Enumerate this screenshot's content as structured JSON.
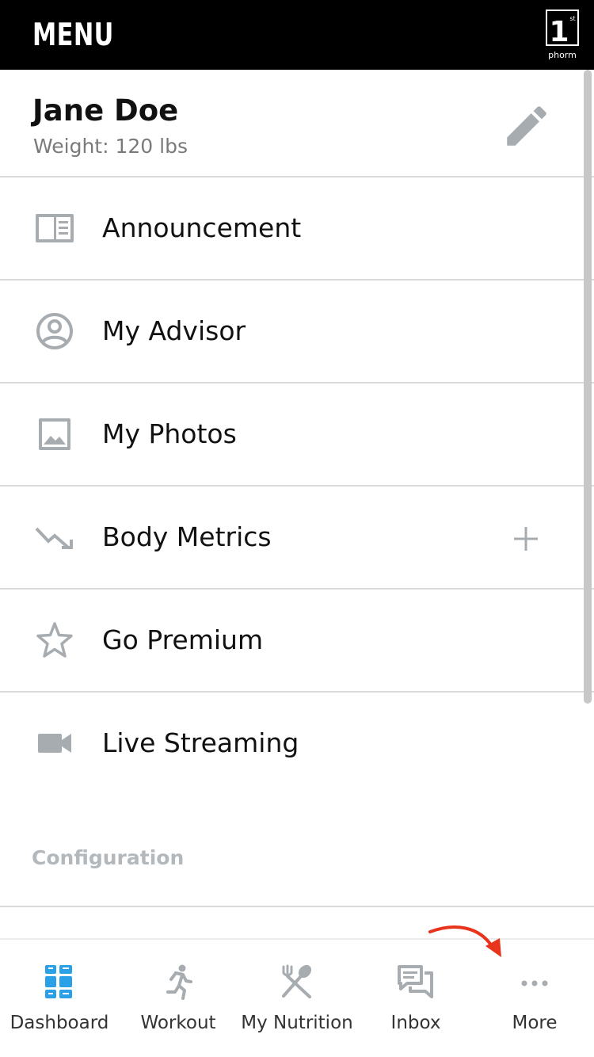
{
  "header": {
    "title": "MENU",
    "logo_text": "1",
    "logo_superscript": "st",
    "logo_subtext": "phorm"
  },
  "profile": {
    "name": "Jane Doe",
    "weight": "Weight: 120 lbs",
    "edit_icon": "pencil-icon"
  },
  "menu": {
    "items": [
      {
        "label": "Announcement",
        "icon": "newspaper-icon"
      },
      {
        "label": "My Advisor",
        "icon": "account-circle-icon"
      },
      {
        "label": "My Photos",
        "icon": "image-icon"
      },
      {
        "label": "Body Metrics",
        "icon": "trend-down-icon",
        "action_icon": "plus-icon"
      },
      {
        "label": "Go Premium",
        "icon": "star-outline-icon"
      },
      {
        "label": "Live Streaming",
        "icon": "video-camera-icon"
      }
    ]
  },
  "configuration": {
    "section_title": "Configuration"
  },
  "tabbar": {
    "tabs": [
      {
        "label": "Dashboard",
        "icon": "dashboard-icon",
        "active": true
      },
      {
        "label": "Workout",
        "icon": "running-icon",
        "active": false
      },
      {
        "label": "My Nutrition",
        "icon": "fork-spoon-icon",
        "active": false
      },
      {
        "label": "Inbox",
        "icon": "chat-bubbles-icon",
        "active": false
      },
      {
        "label": "More",
        "icon": "more-dots-icon",
        "active": false
      }
    ]
  },
  "colors": {
    "header_bg": "#000000",
    "accent_blue": "#2aa0e6",
    "icon_gray": "#a7acb0",
    "divider": "#d9d9d9",
    "section_gray": "#b3b8bc",
    "annotation_red": "#e8341c"
  }
}
